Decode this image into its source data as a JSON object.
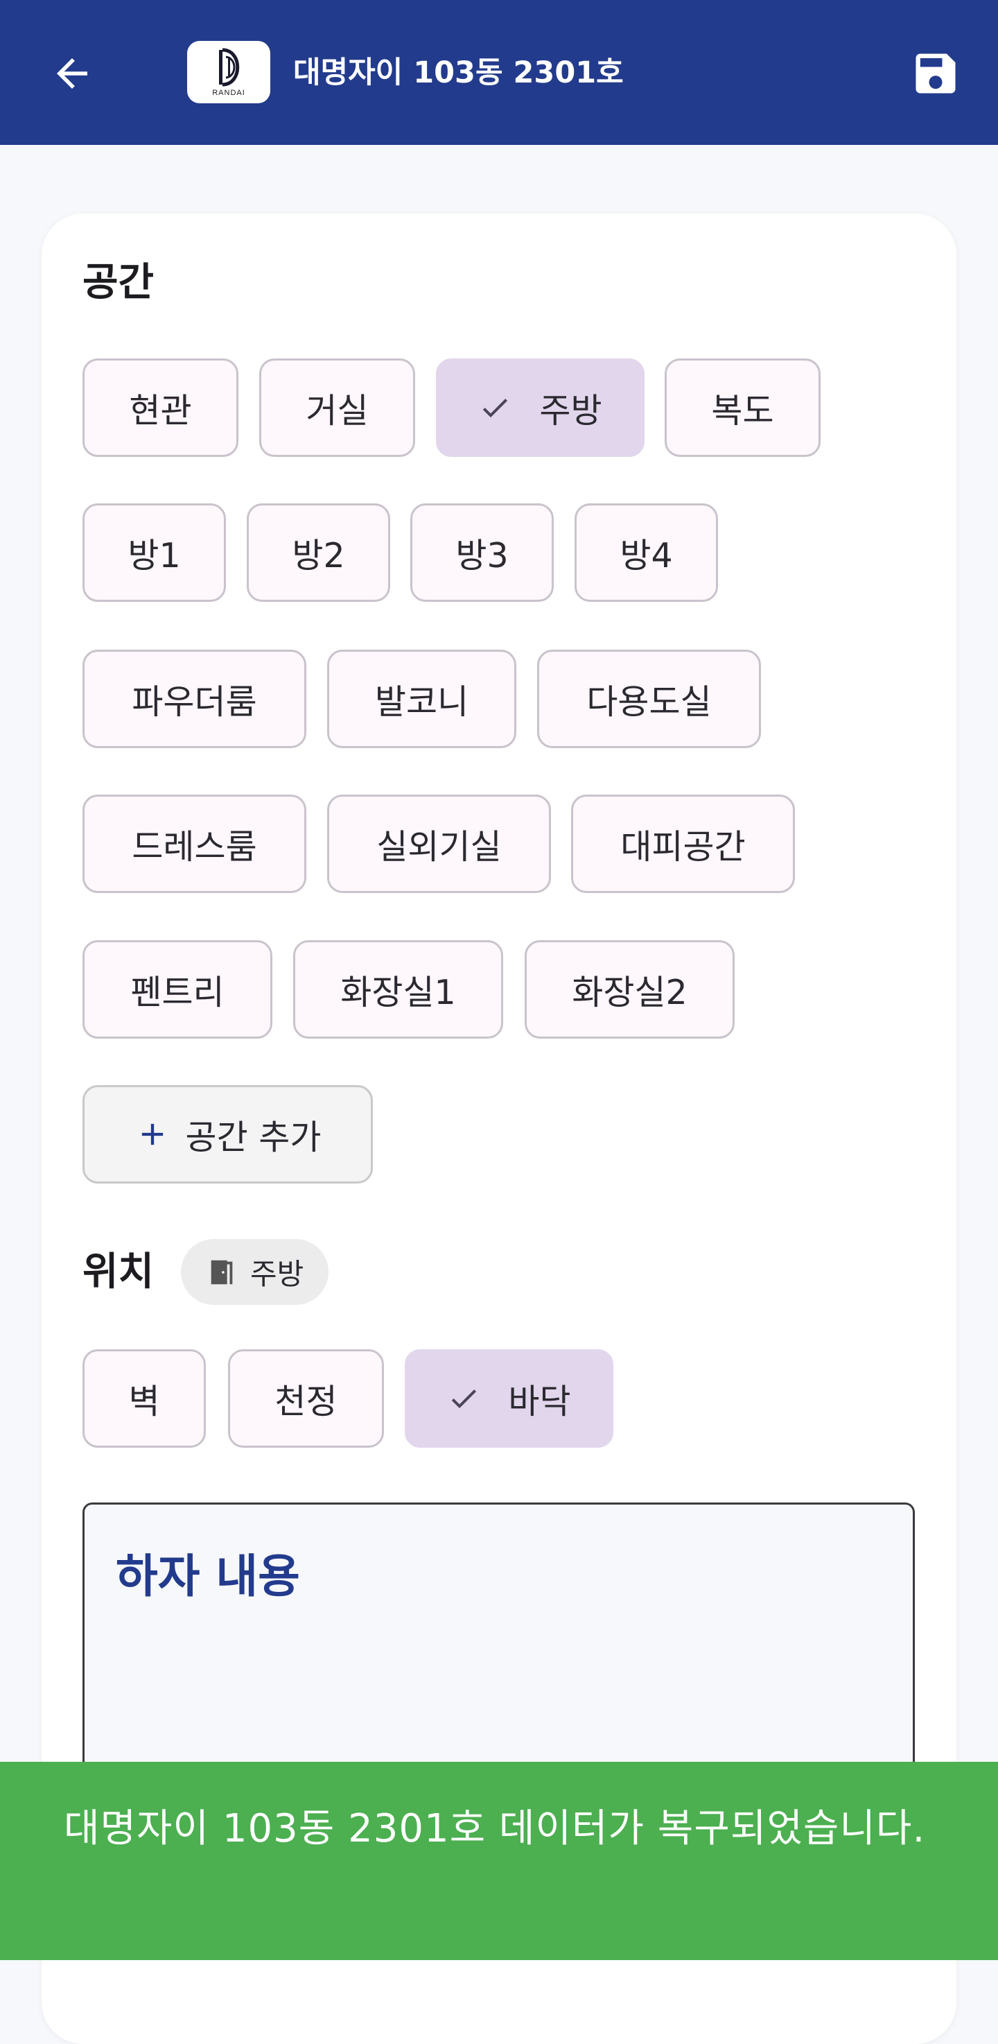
{
  "appbar": {
    "title": "대명자이 103동 2301호",
    "logo_text": "RANDAI",
    "back_icon": "arrow-left-icon",
    "save_icon": "save-icon",
    "background": "#233b8c"
  },
  "space_section": {
    "title": "공간",
    "chips": [
      {
        "label": "현관",
        "selected": false
      },
      {
        "label": "거실",
        "selected": false
      },
      {
        "label": "주방",
        "selected": true
      },
      {
        "label": "복도",
        "selected": false
      },
      {
        "label": "방1",
        "selected": false
      },
      {
        "label": "방2",
        "selected": false
      },
      {
        "label": "방3",
        "selected": false
      },
      {
        "label": "방4",
        "selected": false
      },
      {
        "label": "파우더룸",
        "selected": false
      },
      {
        "label": "발코니",
        "selected": false
      },
      {
        "label": "다용도실",
        "selected": false
      },
      {
        "label": "드레스룸",
        "selected": false
      },
      {
        "label": "실외기실",
        "selected": false
      },
      {
        "label": "대피공간",
        "selected": false
      },
      {
        "label": "펜트리",
        "selected": false
      },
      {
        "label": "화장실1",
        "selected": false
      },
      {
        "label": "화장실2",
        "selected": false
      }
    ],
    "add_label": "공간 추가"
  },
  "location_section": {
    "title": "위치",
    "badge_label": "주방",
    "badge_icon": "door-icon",
    "chips": [
      {
        "label": "벽",
        "selected": false
      },
      {
        "label": "천정",
        "selected": false
      },
      {
        "label": "바닥",
        "selected": true
      }
    ]
  },
  "defect_field": {
    "label": "하자 내용",
    "value": ""
  },
  "snackbar": {
    "message": "대명자이 103동 2301호 데이터가 복구되었습니다.",
    "background": "#4caf50"
  },
  "colors": {
    "chip_selected": "#e1d6ec",
    "chip_default": "#fef7fc",
    "accent": "#233b8c"
  }
}
